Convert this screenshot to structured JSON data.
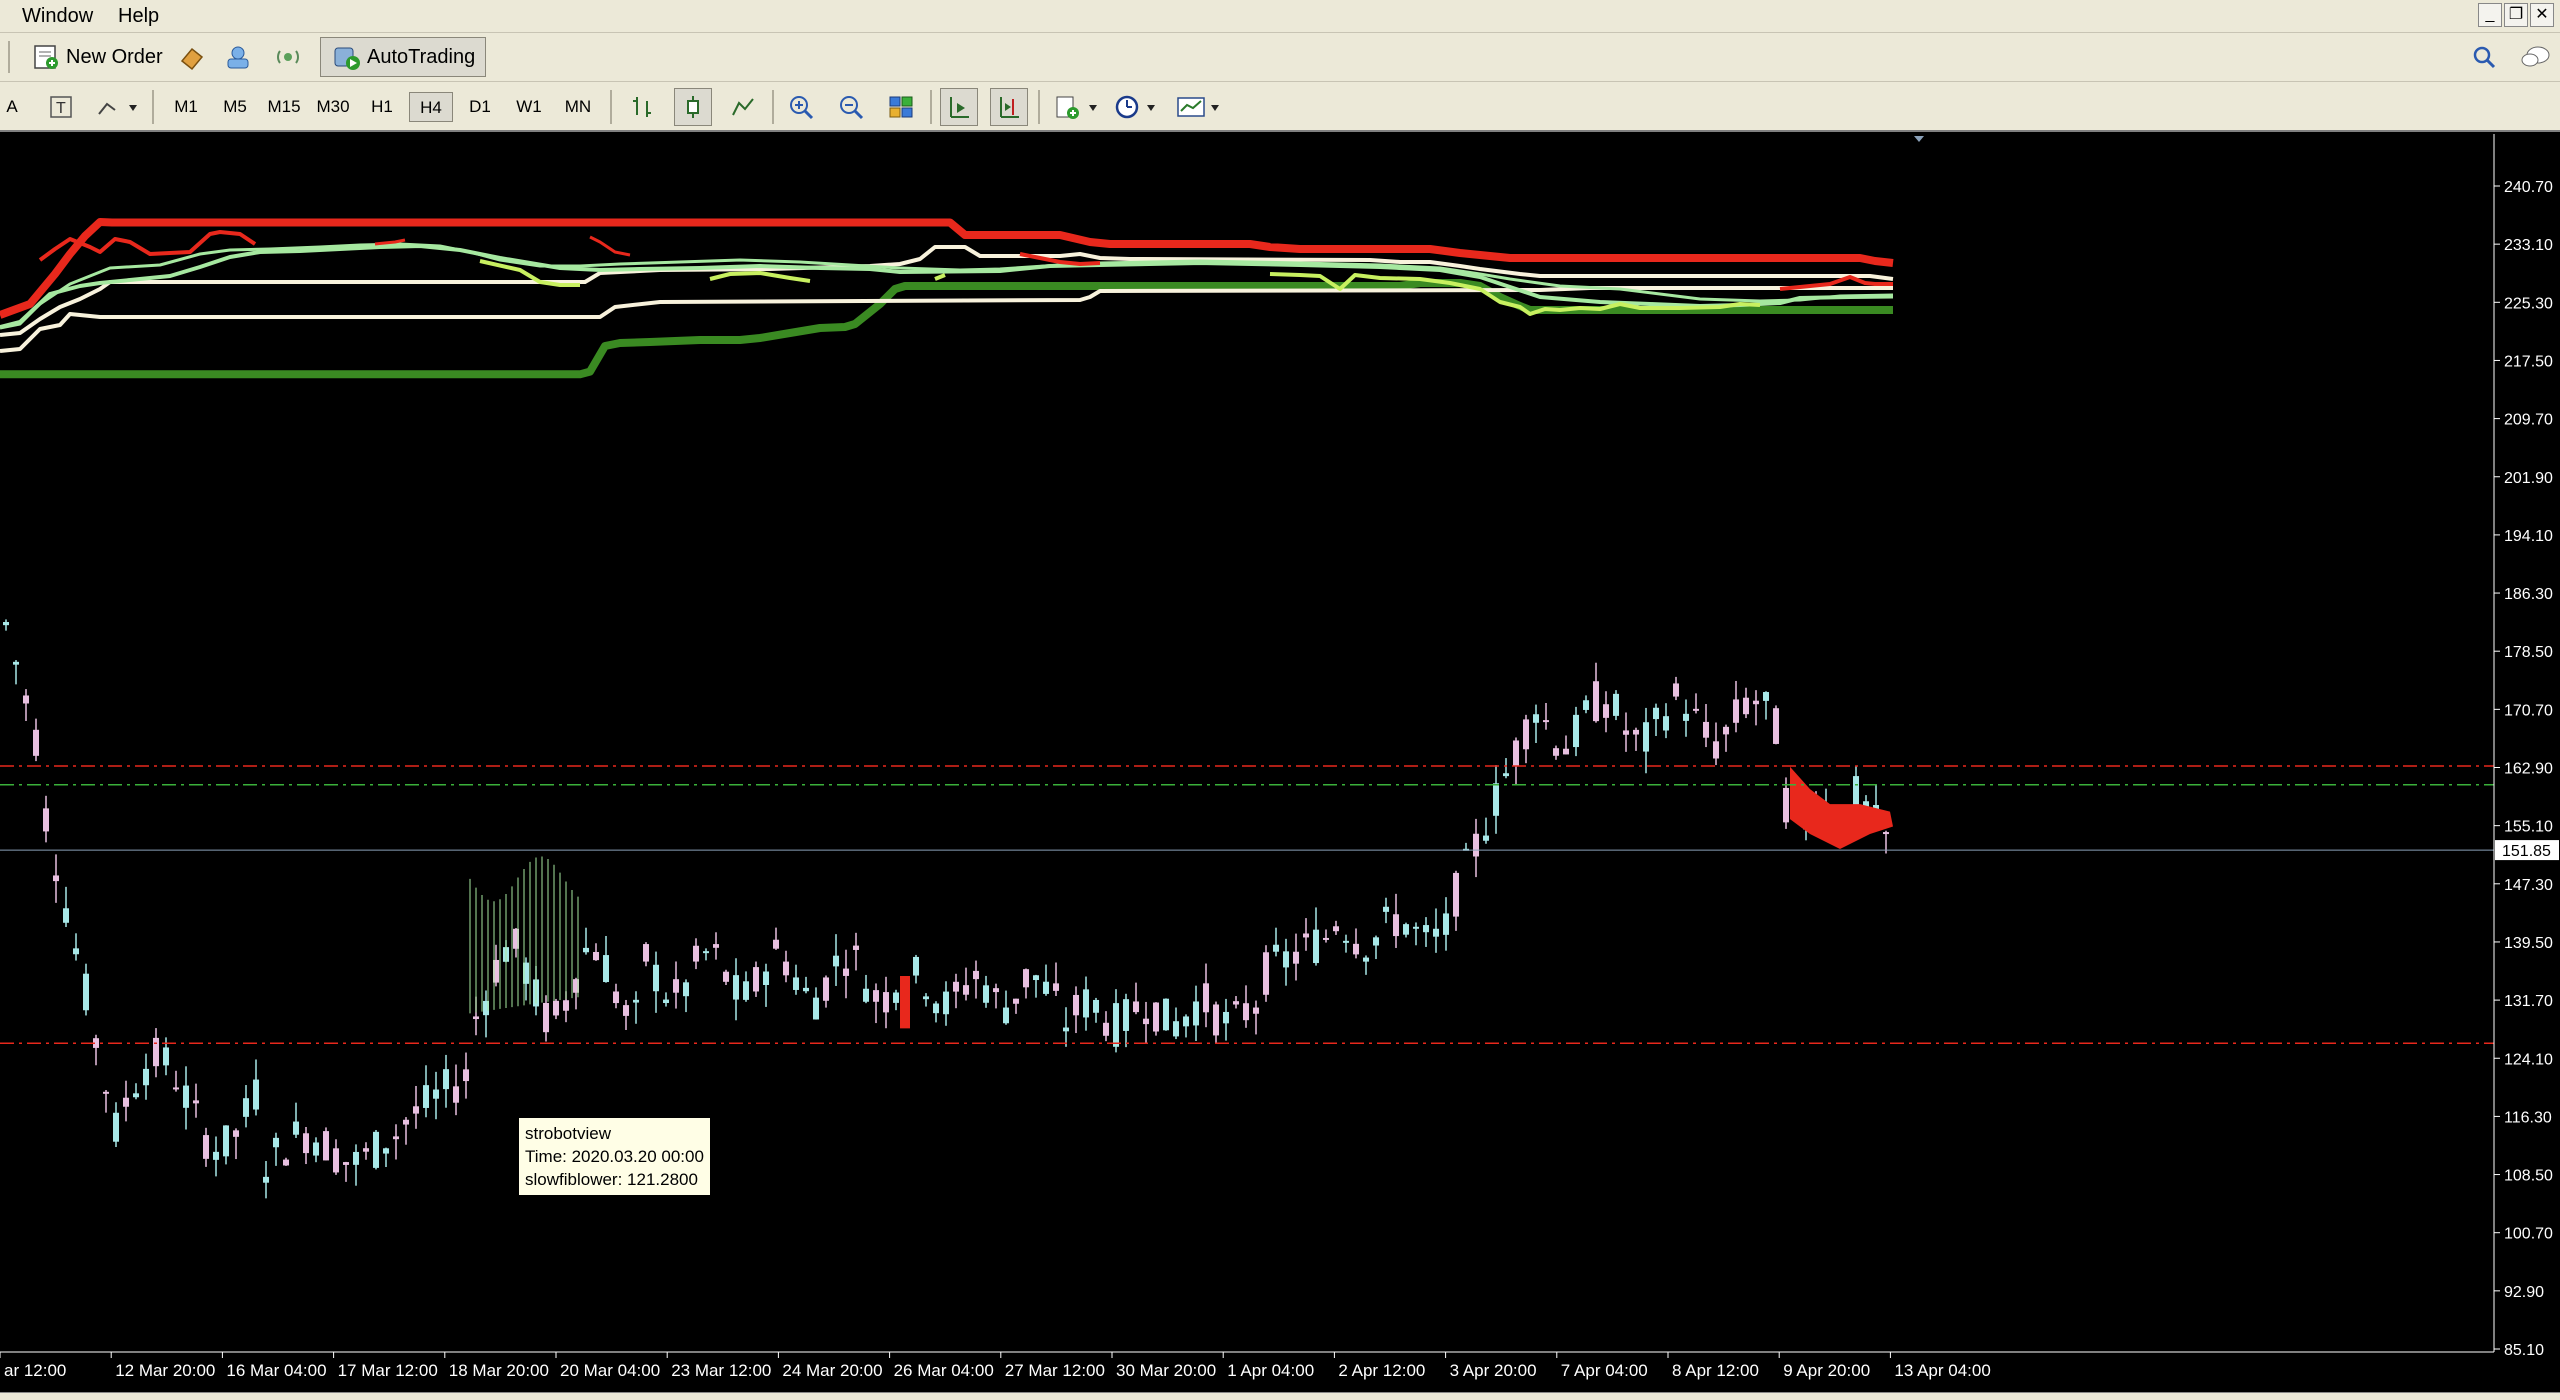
{
  "menu": {
    "items": [
      "Window",
      "Help"
    ]
  },
  "toolbar": {
    "new_order": "New Order",
    "autotrading": "AutoTrading",
    "timeframes": [
      "M1",
      "M5",
      "M15",
      "M30",
      "H1",
      "H4",
      "D1",
      "W1",
      "MN"
    ],
    "active_timeframe": "H4",
    "left_tools": [
      "A",
      "T"
    ]
  },
  "chart": {
    "price_ticks": [
      "240.70",
      "233.10",
      "225.30",
      "217.50",
      "209.70",
      "201.90",
      "194.10",
      "186.30",
      "178.50",
      "170.70",
      "162.90",
      "155.10",
      "147.30",
      "139.50",
      "131.70",
      "124.10",
      "116.30",
      "108.50",
      "100.70",
      "92.90",
      "85.10"
    ],
    "current_price": "151.85",
    "time_ticks": [
      "ar 12:00",
      "12 Mar 20:00",
      "16 Mar 04:00",
      "17 Mar 12:00",
      "18 Mar 20:00",
      "20 Mar 04:00",
      "23 Mar 12:00",
      "24 Mar 20:00",
      "26 Mar 04:00",
      "27 Mar 12:00",
      "30 Mar 20:00",
      "1 Apr 04:00",
      "2 Apr 12:00",
      "3 Apr 20:00",
      "7 Apr 04:00",
      "8 Apr 12:00",
      "9 Apr 20:00",
      "13 Apr 04:00"
    ],
    "colors": {
      "background": "#000000",
      "dark_green": "#3a8a22",
      "red": "#e8281c",
      "cream": "#f8f2dc",
      "light_green": "#a6e8a0",
      "yellow_green": "#c8f060",
      "candle_cyan": "#a8e8e8",
      "candle_pink": "#e8c0e0"
    }
  },
  "tooltip": {
    "title": "strobotview",
    "time": "Time: 2020.03.20 00:00",
    "value": "slowfiblower: 121.2800"
  }
}
